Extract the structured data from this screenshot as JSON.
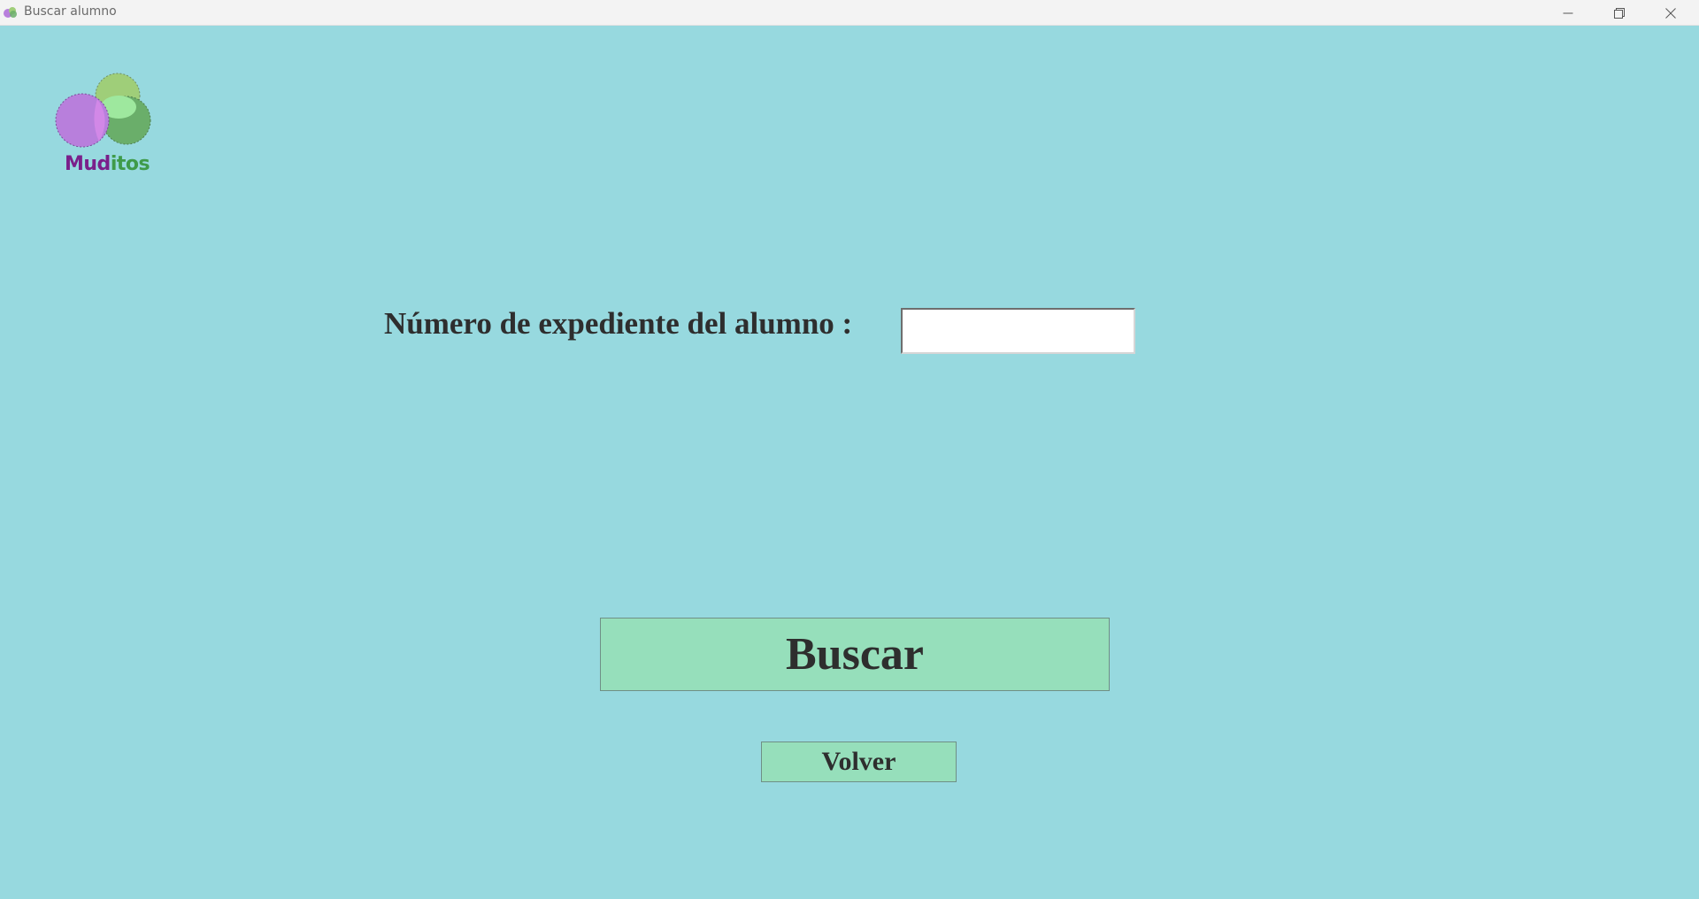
{
  "window": {
    "title": "Buscar alumno",
    "background_color": "#97d9df",
    "controls": {
      "minimize_icon": "minimize-icon",
      "maximize_icon": "restore-icon",
      "close_icon": "close-icon"
    }
  },
  "logo": {
    "text_part1": "Mud",
    "text_part2": "itos",
    "colors": {
      "purple_circle": "#b87fdc",
      "green_circle": "#9fce79",
      "dark_green_circle": "#6aae6a",
      "overlap": "#9ee89e",
      "text_purple": "#7a1f8a",
      "text_green": "#3f9b4a"
    }
  },
  "form": {
    "label": "Número de expediente del alumno :",
    "expediente_value": "",
    "expediente_placeholder": ""
  },
  "buttons": {
    "search_label": "Buscar",
    "back_label": "Volver",
    "color": "#96dfbb"
  }
}
